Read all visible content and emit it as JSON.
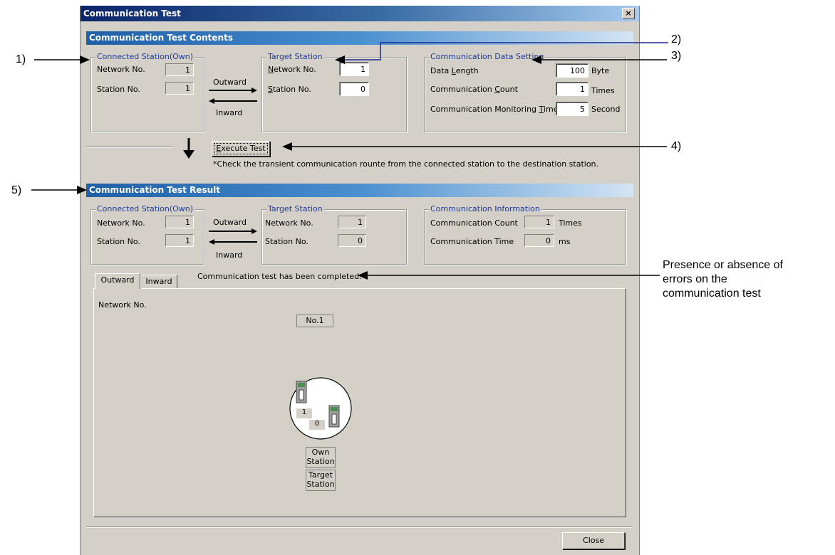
{
  "window": {
    "title": "Communication Test",
    "close_glyph": "×"
  },
  "contents": {
    "header": "Communication Test Contents",
    "connected": {
      "legend": "Connected Station(Own)",
      "network_label": "Network No.",
      "network_value": "1",
      "station_label": "Station No.",
      "station_value": "1"
    },
    "outward_label": "Outward",
    "inward_label": "Inward",
    "target": {
      "legend": "Target Station",
      "network_label_pre": "",
      "network_label_key": "N",
      "network_label_post": "etwork No.",
      "network_value": "1",
      "station_label_key": "S",
      "station_label_post": "tation No.",
      "station_value": "0"
    },
    "data_setting": {
      "legend": "Communication Data Setting",
      "data_length_pre": "Data ",
      "data_length_key": "L",
      "data_length_post": "ength",
      "data_length_value": "100",
      "data_length_unit": "Byte",
      "count_pre": "Communication ",
      "count_key": "C",
      "count_post": "ount",
      "count_value": "1",
      "count_unit": "Times",
      "time_pre": "Communication Monitoring ",
      "time_key": "T",
      "time_post": "ime",
      "time_value": "5",
      "time_unit": "Second"
    }
  },
  "execute": {
    "key": "E",
    "label_rest": "xecute Test",
    "note": "*Check the transient communication rounte from the connected station to the destination station."
  },
  "result": {
    "header": "Communication Test Result",
    "connected": {
      "legend": "Connected Station(Own)",
      "network_label": "Network No.",
      "network_value": "1",
      "station_label": "Station No.",
      "station_value": "1"
    },
    "outward_label": "Outward",
    "inward_label": "Inward",
    "target": {
      "legend": "Target Station",
      "network_label": "Network No.",
      "network_value": "1",
      "station_label": "Station No.",
      "station_value": "0"
    },
    "info": {
      "legend": "Communication Information",
      "count_label": "Communication Count",
      "count_value": "1",
      "count_unit": "Times",
      "time_label": "Communication Time",
      "time_value": "0",
      "time_unit": "ms"
    }
  },
  "tabs": {
    "outward": "Outward",
    "inward": "Inward",
    "status": "Communication test has been completed."
  },
  "diagram": {
    "network_label": "Network No.",
    "network_tag": "No.1",
    "own_station_num": "1",
    "target_station_num": "0",
    "own_label_1": "Own",
    "own_label_2": "Station",
    "target_label_1": "Target",
    "target_label_2": "Station"
  },
  "close_label": "Close",
  "annotations": {
    "a1": "1)",
    "a2": "2)",
    "a3": "3)",
    "a4": "4)",
    "a5": "5)",
    "note_line1": "Presence or absence of",
    "note_line2": "errors on the",
    "note_line3": "communication test"
  }
}
